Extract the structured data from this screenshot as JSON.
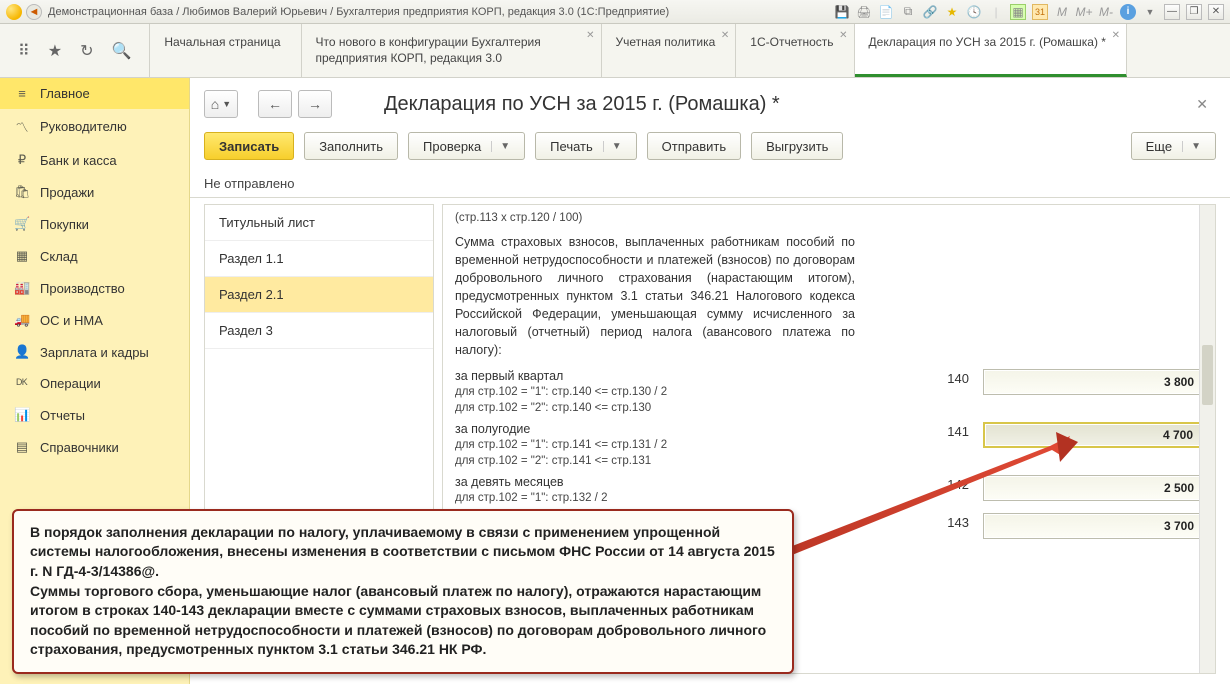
{
  "titlebar": {
    "text": "Демонстрационная база / Любимов Валерий Юрьевич / Бухгалтерия предприятия КОРП, редакция 3.0  (1С:Предприятие)",
    "m1": "M",
    "m2": "M+",
    "m3": "M-",
    "cal": "31"
  },
  "tabs": [
    {
      "label": "Начальная страница"
    },
    {
      "label": "Что нового в конфигурации Бухгалтерия предприятия КОРП, редакция 3.0"
    },
    {
      "label": "Учетная политика"
    },
    {
      "label": "1С-Отчетность"
    },
    {
      "label": "Декларация по УСН за 2015 г. (Ромашка) *",
      "active": true
    }
  ],
  "sidebar": [
    {
      "icon": "≡",
      "label": "Главное",
      "active": true
    },
    {
      "icon": "〽",
      "label": "Руководителю"
    },
    {
      "icon": "₽",
      "label": "Банк и касса"
    },
    {
      "icon": "🛍",
      "label": "Продажи"
    },
    {
      "icon": "🛒",
      "label": "Покупки"
    },
    {
      "icon": "▦",
      "label": "Склад"
    },
    {
      "icon": "🏭",
      "label": "Производство"
    },
    {
      "icon": "🚚",
      "label": "ОС и НМА"
    },
    {
      "icon": "👤",
      "label": "Зарплата и кадры"
    },
    {
      "icon": "ᴰᴷ",
      "label": "Операции"
    },
    {
      "icon": "📊",
      "label": "Отчеты"
    },
    {
      "icon": "▤",
      "label": "Справочники"
    }
  ],
  "doc": {
    "title": "Декларация по УСН за 2015 г. (Ромашка) *",
    "write": "Записать",
    "fill": "Заполнить",
    "check": "Проверка",
    "print": "Печать",
    "send": "Отправить",
    "export": "Выгрузить",
    "more": "Еще",
    "status": "Не отправлено"
  },
  "sections": [
    {
      "label": "Титульный лист"
    },
    {
      "label": "Раздел 1.1"
    },
    {
      "label": "Раздел 2.1",
      "active": true
    },
    {
      "label": "Раздел 3"
    }
  ],
  "form": {
    "top": "(стр.113 x стр.120 / 100)",
    "para": "Сумма страховых взносов, выплаченных работникам пособий по временной нетрудоспособности и платежей (взносов) по договорам добровольного личного страхования (нарастающим итогом), предусмотренных пунктом 3.1 статьи 346.21 Налогового кодекса Российской Федерации, уменьшающая сумму исчисленного за налоговый (отчетный) период налога (авансового платежа по налогу):",
    "rows": [
      {
        "hd": "за первый квартал",
        "l1": "для стр.102 = \"1\": стр.140 <= стр.130 / 2",
        "l2": "для стр.102 = \"2\": стр.140 <= стр.130",
        "code": "140",
        "val": "3 800"
      },
      {
        "hd": "за полугодие",
        "l1": "для стр.102 = \"1\": стр.141 <= стр.131 / 2",
        "l2": "для стр.102 = \"2\": стр.141 <= стр.131",
        "code": "141",
        "val": "4 700",
        "hl": true
      },
      {
        "hd": "за девять месяцев",
        "l1": "для стр.102 = \"1\": стр.132 / 2",
        "l2": "",
        "code": "142",
        "val": "2 500"
      },
      {
        "hd": "",
        "l1": "",
        "l2": "",
        "code": "143",
        "val": "3 700"
      }
    ]
  },
  "callout": "В порядок заполнения декларации по налогу, уплачиваемому в связи с применением упрощенной системы налогообложения, внесены изменения в соответствии с письмом ФНС России от 14 августа 2015 г. N ГД-4-3/14386@.\nСуммы торгового сбора, уменьшающие налог (авансовый платеж по налогу), отражаются нарастающим итогом в строках 140-143 декларации вместе с суммами страховых взносов, выплаченных работникам пособий по временной нетрудоспособности и платежей (взносов) по договорам добровольного личного страхования, предусмотренных пунктом 3.1 статьи 346.21 НК РФ."
}
